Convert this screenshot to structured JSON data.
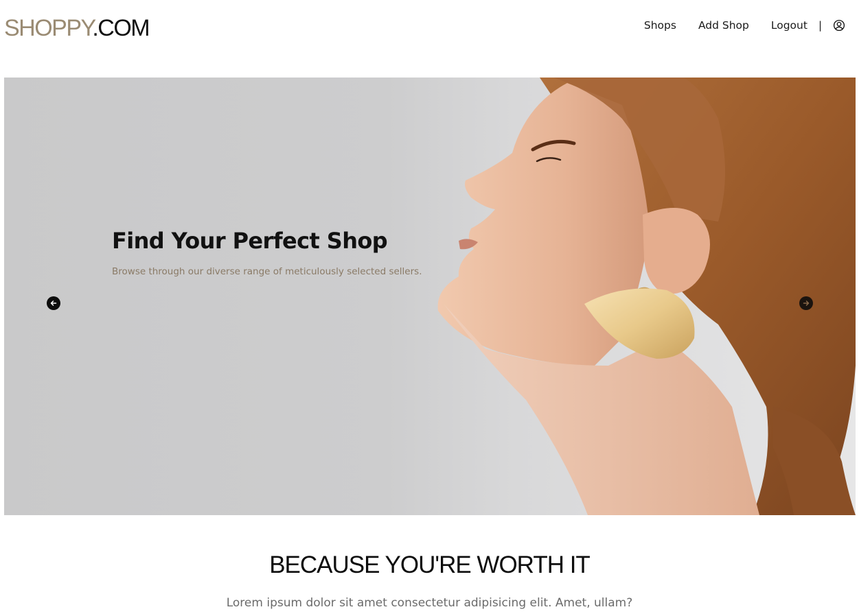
{
  "header": {
    "logo": {
      "brand": "SHOPPY",
      "tld": ".COM"
    },
    "nav": {
      "shops": "Shops",
      "add_shop": "Add Shop",
      "logout": "Logout",
      "separator": "|",
      "profile_icon": "user-circle-icon"
    }
  },
  "hero": {
    "title": "Find Your Perfect Shop",
    "subtitle": "Browse through our diverse range of meticulously selected sellers.",
    "prev_icon": "arrow-left-icon",
    "next_icon": "arrow-right-icon"
  },
  "section": {
    "title": "BECAUSE YOU'RE WORTH IT",
    "text": "Lorem ipsum dolor sit amet consectetur adipisicing elit. Amet, ullam?"
  },
  "colors": {
    "brand": "#9a8b73",
    "subtitle": "#8a7a66",
    "hero_bg": "#cbcbcc",
    "hair": "#9b5a2b",
    "skin": "#e8b898",
    "earring": "#e8c98a"
  }
}
